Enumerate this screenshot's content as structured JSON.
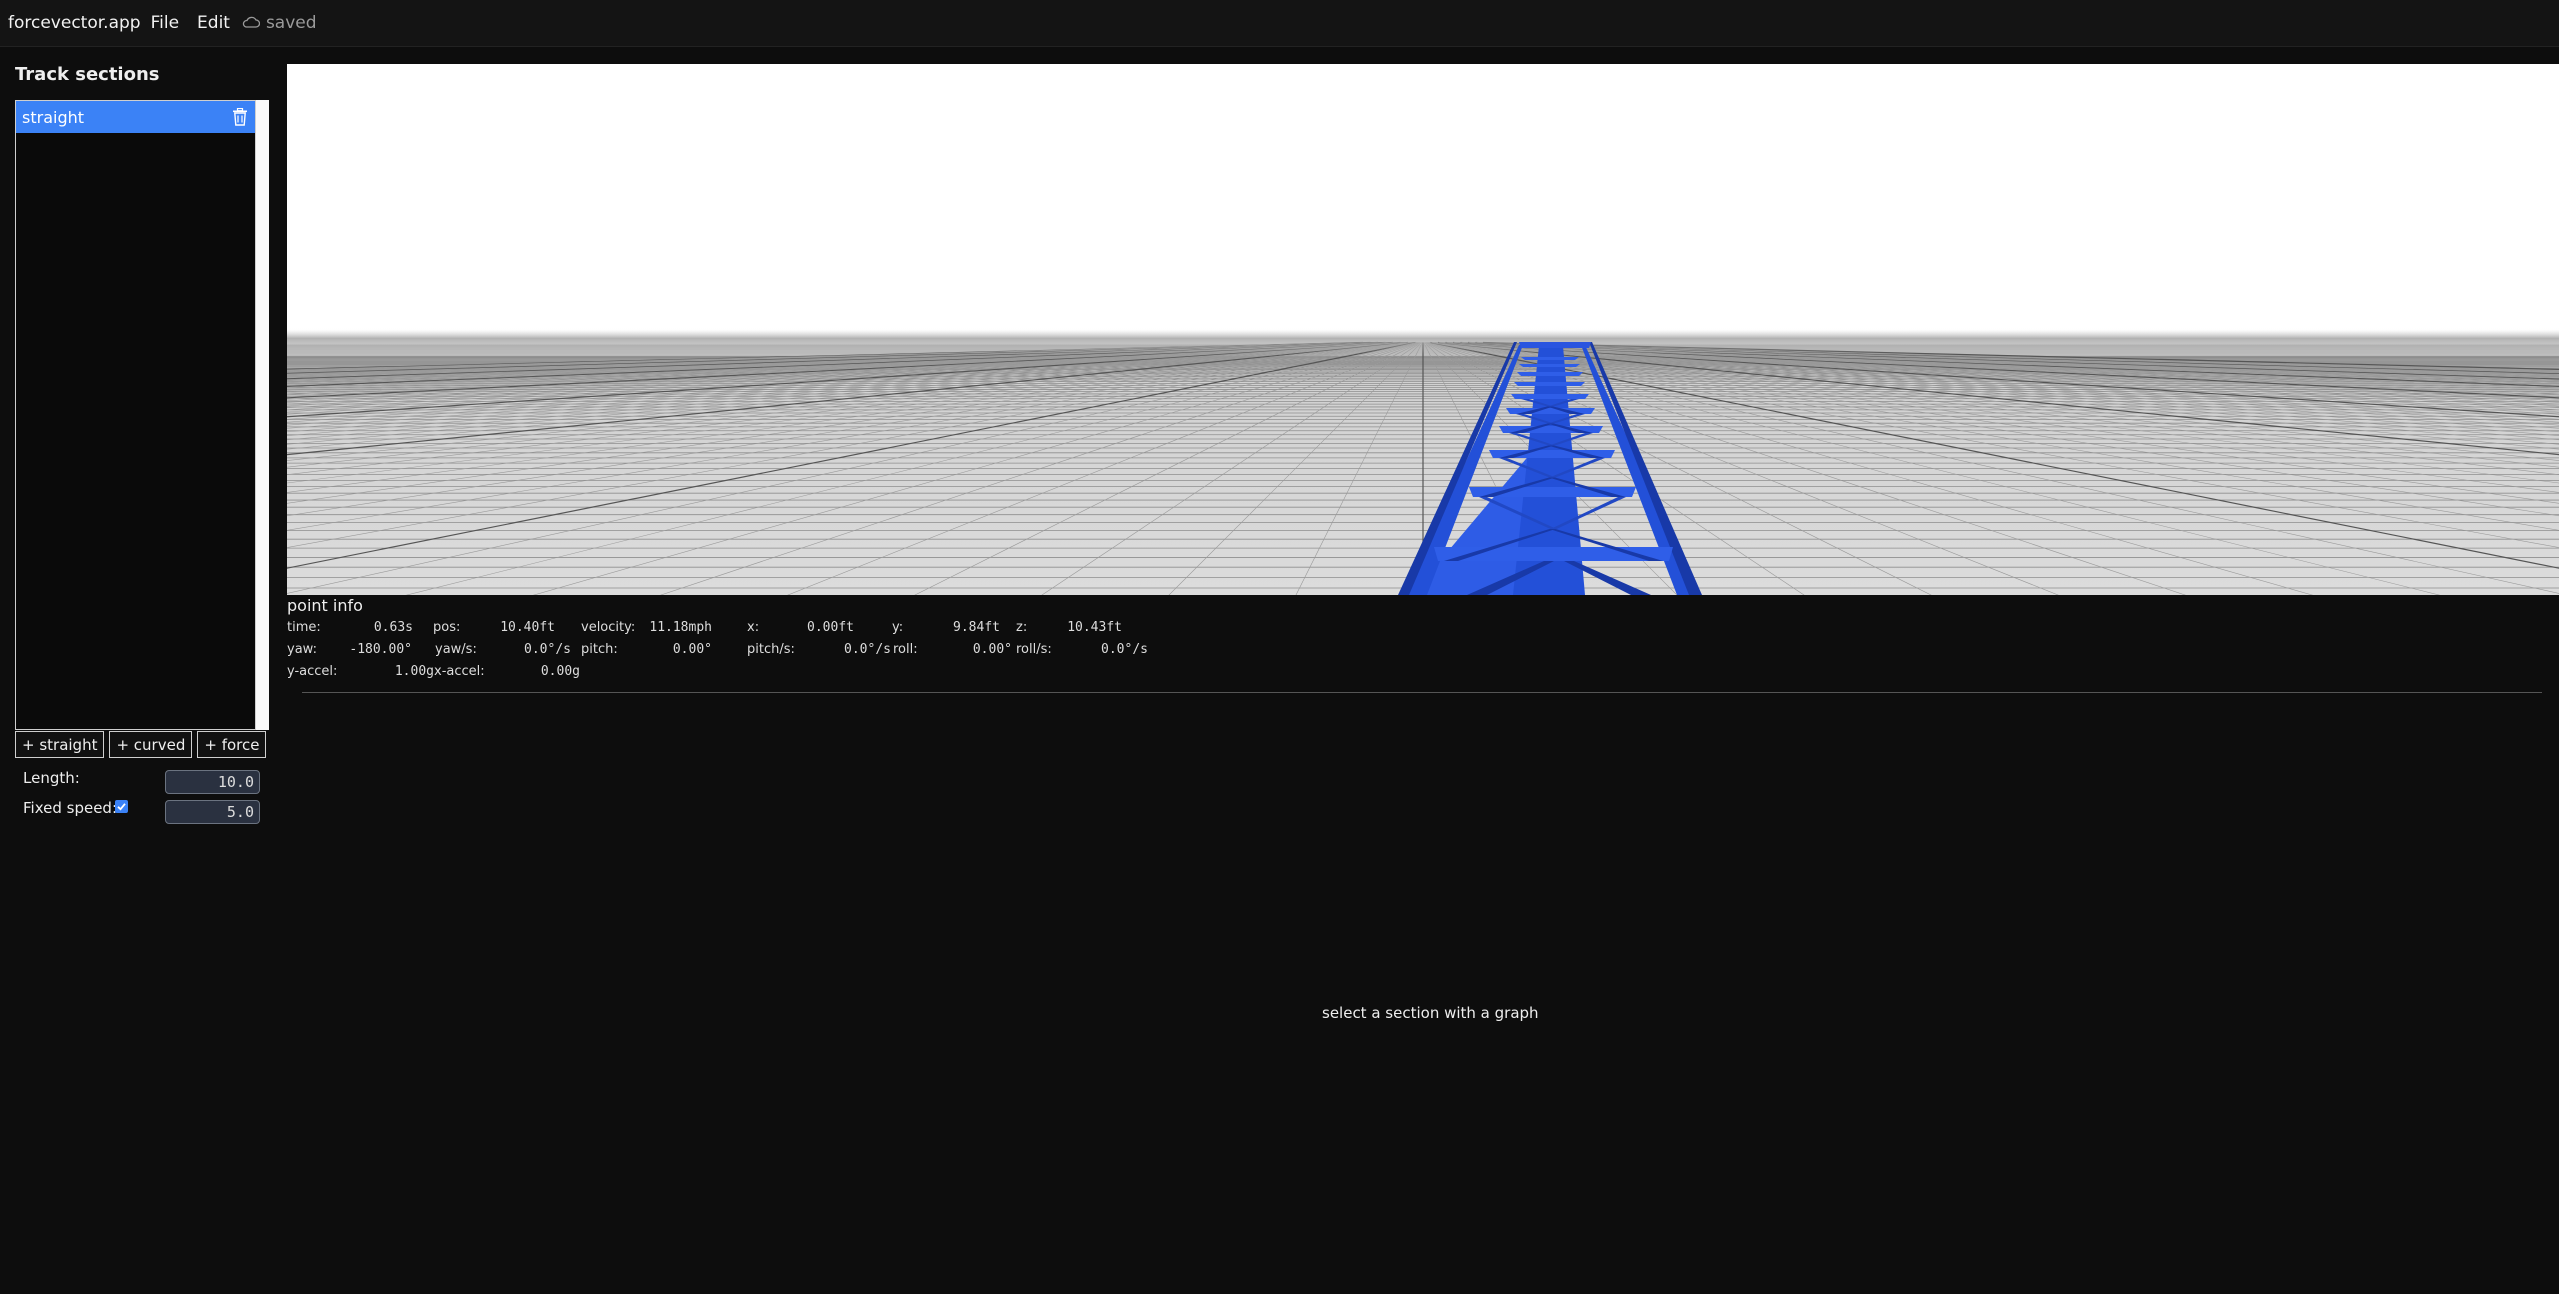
{
  "topbar": {
    "app_name": "forcevector.app",
    "menu_file": "File",
    "menu_edit": "Edit",
    "status_icon": "cloud-icon",
    "status_text": "saved"
  },
  "sidebar": {
    "title": "Track sections",
    "sections": [
      {
        "label": "straight",
        "selected": true,
        "icon": "trash-icon"
      }
    ],
    "add_buttons": [
      "+ straight",
      "+ curved",
      "+ force"
    ],
    "properties": {
      "length_label": "Length:",
      "length_value": "10.0",
      "fixed_speed_label": "Fixed speed:",
      "fixed_speed_checked": true,
      "fixed_speed_value": "5.0"
    }
  },
  "viewport": {
    "track_color": "#2350d8",
    "sky_color": "#ffffff",
    "ground_color": "#dcdcdc"
  },
  "point_info": {
    "title": "point info",
    "fields": [
      {
        "label": "time:",
        "value": "0.63s"
      },
      {
        "label": "pos:",
        "value": "10.40ft"
      },
      {
        "label": "velocity:",
        "value": "11.18mph"
      },
      {
        "label": "x:",
        "value": "0.00ft"
      },
      {
        "label": "y:",
        "value": "9.84ft"
      },
      {
        "label": "z:",
        "value": "10.43ft"
      },
      {
        "label": "yaw:",
        "value": "-180.00°"
      },
      {
        "label": "yaw/s:",
        "value": "0.0°/s"
      },
      {
        "label": "pitch:",
        "value": "0.00°"
      },
      {
        "label": "pitch/s:",
        "value": "0.0°/s"
      },
      {
        "label": "roll:",
        "value": "0.00°"
      },
      {
        "label": "roll/s:",
        "value": "0.0°/s"
      },
      {
        "label": "y-accel:",
        "value": "1.00g"
      },
      {
        "label": "x-accel:",
        "value": "0.00g"
      }
    ]
  },
  "graph": {
    "message": "select a section with a graph"
  }
}
